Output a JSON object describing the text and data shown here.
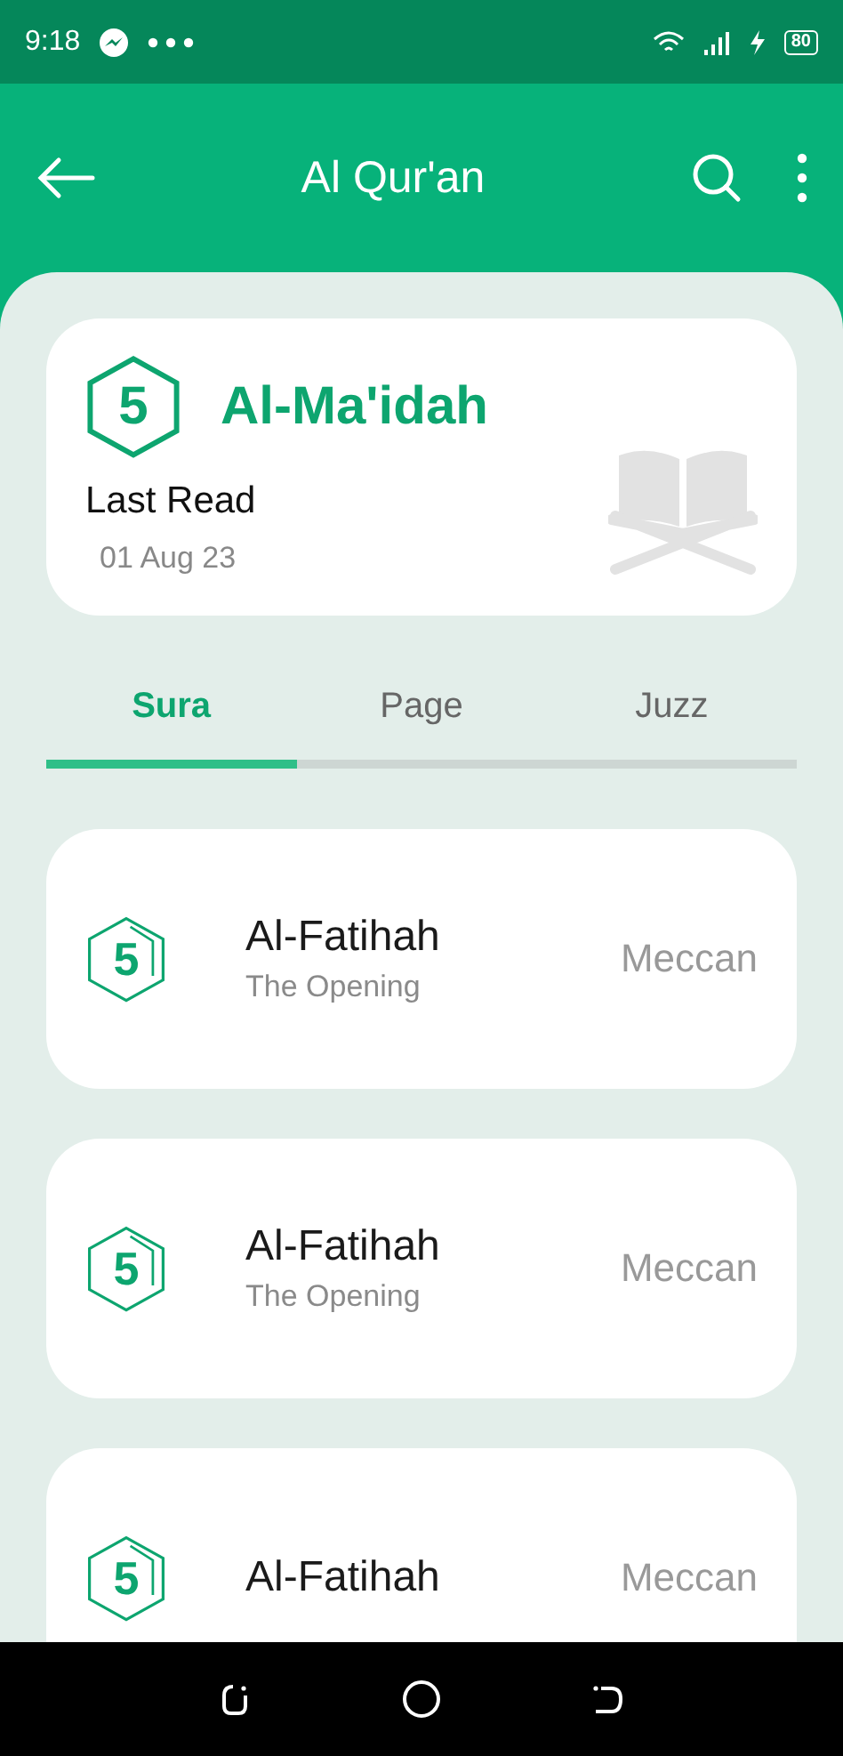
{
  "status_bar": {
    "time": "9:18",
    "battery": "80"
  },
  "app_bar": {
    "title": "Al Qur'an"
  },
  "last_read": {
    "number": "5",
    "sura": "Al-Ma'idah",
    "label": "Last Read",
    "date": "01 Aug 23"
  },
  "tabs": [
    {
      "label": "Sura",
      "selected": true
    },
    {
      "label": "Page",
      "selected": false
    },
    {
      "label": "Juzz",
      "selected": false
    }
  ],
  "suras": [
    {
      "number": "5",
      "name": "Al-Fatihah",
      "meaning": "The Opening",
      "place": "Meccan"
    },
    {
      "number": "5",
      "name": "Al-Fatihah",
      "meaning": "The Opening",
      "place": "Meccan"
    },
    {
      "number": "5",
      "name": "Al-Fatihah",
      "place": "Meccan"
    }
  ]
}
